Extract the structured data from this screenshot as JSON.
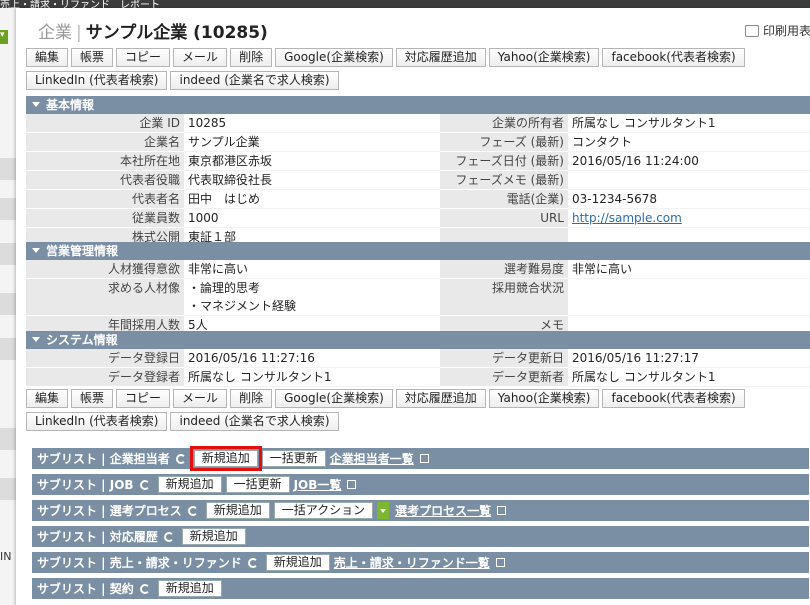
{
  "background": {
    "topbar_text": "売上・請求・リファンド　レポート"
  },
  "modal": {
    "category": "企業",
    "title": "サンプル企業 (10285)",
    "print_label": "印刷用表"
  },
  "toolbar": {
    "row1": [
      "編集",
      "帳票",
      "コピー",
      "メール",
      "削除",
      "Google(企業検索)",
      "対応履歴追加",
      "Yahoo(企業検索)",
      "facebook(代表者検索)"
    ],
    "row2": [
      "LinkedIn (代表者検索)",
      "indeed (企業名で求人検索)"
    ]
  },
  "sections": {
    "basic": {
      "title": "基本情報",
      "rows": [
        {
          "l1": "企業 ID",
          "v1": "10285",
          "l2": "企業の所有者",
          "v2": "所属なし コンサルタント1"
        },
        {
          "l1": "企業名",
          "v1": "サンプル企業",
          "l2": "フェーズ (最新)",
          "v2": "コンタクト"
        },
        {
          "l1": "本社所在地",
          "v1": "東京都港区赤坂",
          "l2": "フェーズ日付 (最新)",
          "v2": "2016/05/16 11:24:00"
        },
        {
          "l1": "代表者役職",
          "v1": "代表取締役社長",
          "l2": "フェーズメモ (最新)",
          "v2": ""
        },
        {
          "l1": "代表者名",
          "v1": "田中　はじめ",
          "l2": "電話(企業)",
          "v2": "03-1234-5678"
        },
        {
          "l1": "従業員数",
          "v1": "1000",
          "l2": "URL",
          "v2": "http://sample.com"
        },
        {
          "l1": "株式公開",
          "v1": "東証１部",
          "l2": "",
          "v2": ""
        }
      ]
    },
    "sales": {
      "title": "営業管理情報",
      "rows": [
        {
          "l1": "人材獲得意欲",
          "v1": "非常に高い",
          "l2": "選考難易度",
          "v2": "非常に高い"
        },
        {
          "l1": "求める人材像",
          "v1": "・論理的思考",
          "v1b": "・マネジメント経験",
          "l2": "採用競合状況",
          "v2": ""
        },
        {
          "l1": "年間採用人数",
          "v1": "5人",
          "l2": "メモ",
          "v2": ""
        }
      ]
    },
    "system": {
      "title": "システム情報",
      "rows": [
        {
          "l1": "データ登録日",
          "v1": "2016/05/16 11:27:16",
          "l2": "データ更新日",
          "v2": "2016/05/16 11:27:17"
        },
        {
          "l1": "データ登録者",
          "v1": "所属なし コンサルタント1",
          "l2": "データ更新者",
          "v2": "所属なし コンサルタント1"
        }
      ]
    }
  },
  "sublists": [
    {
      "title": "サブリスト | 企業担当者",
      "buttons": [
        "新規追加",
        "一括更新"
      ],
      "link": "企業担当者一覧",
      "highlight": 0
    },
    {
      "title": "サブリスト | JOB",
      "buttons": [
        "新規追加",
        "一括更新"
      ],
      "link": "JOB一覧"
    },
    {
      "title": "サブリスト | 選考プロセス",
      "buttons": [
        "新規追加"
      ],
      "select": "一括アクション",
      "link": "選考プロセス一覧"
    },
    {
      "title": "サブリスト | 対応履歴",
      "buttons": [
        "新規追加"
      ]
    },
    {
      "title": "サブリスト | 売上・請求・リファンド",
      "buttons": [
        "新規追加"
      ],
      "link": "売上・請求・リファンド一覧"
    },
    {
      "title": "サブリスト | 契約",
      "buttons": [
        "新規追加"
      ]
    }
  ],
  "colors": {
    "section_header": "#7a8ea4",
    "label_bg": "#e9e9e9",
    "highlight": "#e01010",
    "select_arrow": "#7cb82f"
  }
}
